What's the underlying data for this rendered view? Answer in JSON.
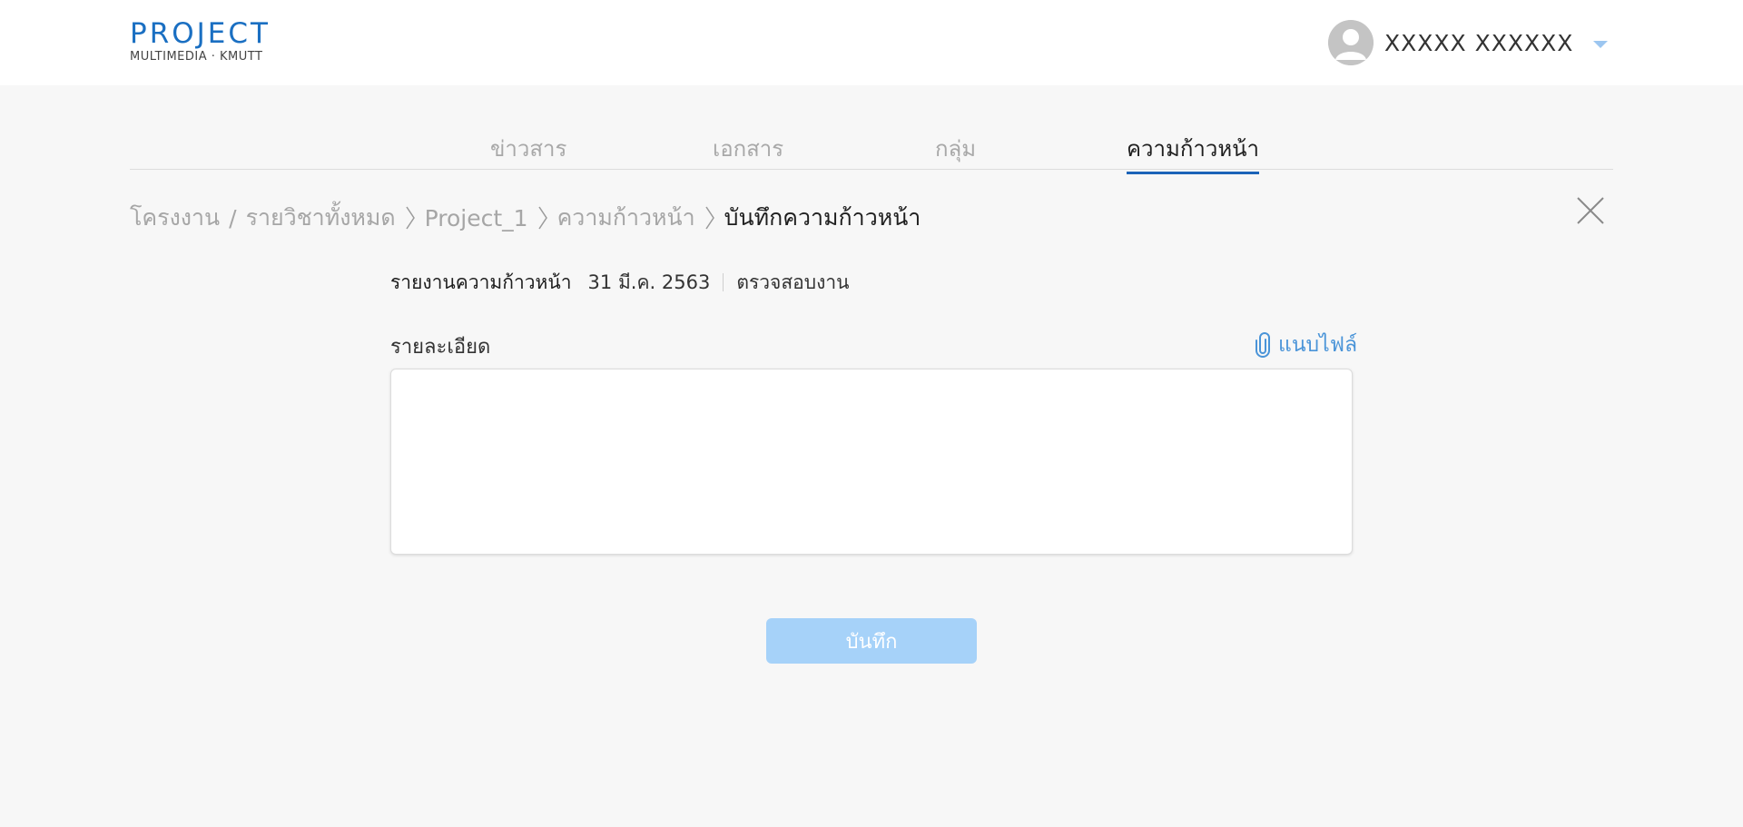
{
  "header": {
    "logo_main": "PROJECT",
    "logo_sub": "MULTIMEDIA · KMUTT",
    "user_name": "XXXXX XXXXXX",
    "accent_color": "#1b63b8"
  },
  "tabs": [
    {
      "label": "ข่าวสาร",
      "active": false
    },
    {
      "label": "เอกสาร",
      "active": false
    },
    {
      "label": "กลุ่ม",
      "active": false
    },
    {
      "label": "ความก้าวหน้า",
      "active": true
    }
  ],
  "breadcrumb": {
    "root": "โครงงาน",
    "slash": "/",
    "items": [
      "รายวิชาทั้งหมด",
      "Project_1",
      "ความก้าวหน้า"
    ],
    "current": "บันทึกความก้าวหน้า"
  },
  "report": {
    "title": "รายงานความก้าวหน้า",
    "date": "31 มี.ค. 2563",
    "status": "ตรวจสอบงาน"
  },
  "detail": {
    "label": "รายละเอียด",
    "value": "",
    "placeholder": ""
  },
  "attach": {
    "label": "แนบไฟล์",
    "icon": "paperclip-icon"
  },
  "save_button": {
    "label": "บันทึก",
    "color": "#a6d2f9"
  }
}
